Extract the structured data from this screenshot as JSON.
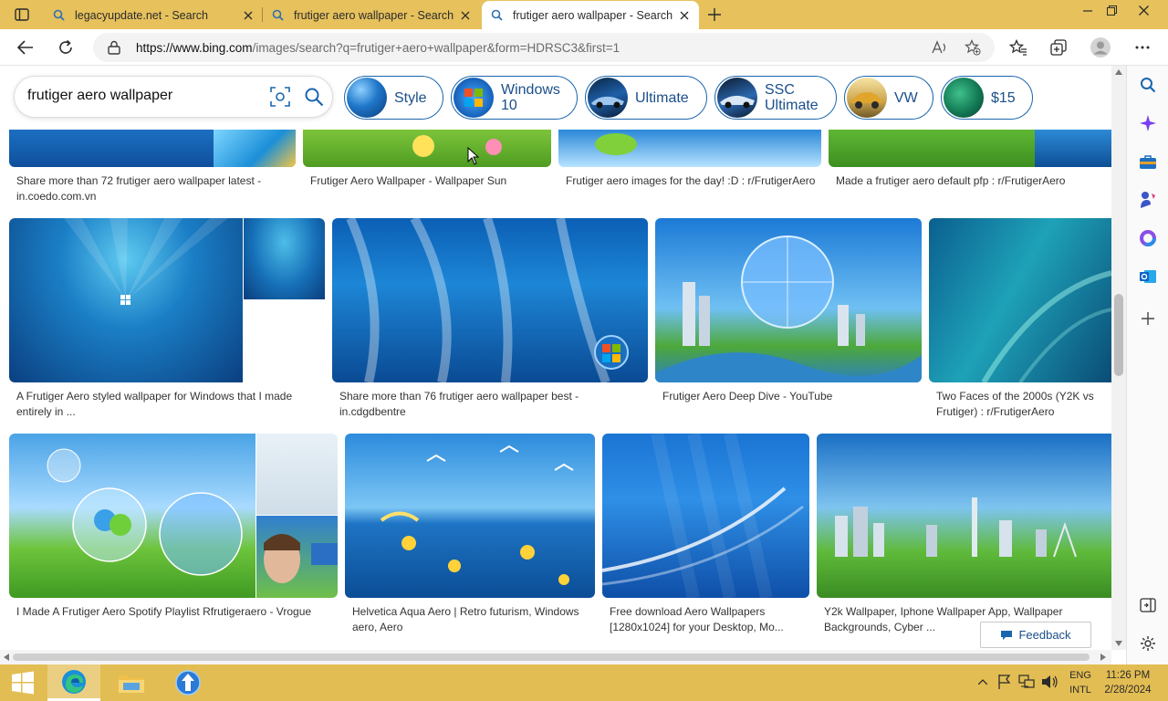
{
  "browser": {
    "tabs": [
      {
        "title": "legacyupdate.net - Search",
        "active": false
      },
      {
        "title": "frutiger aero wallpaper - Search",
        "active": false
      },
      {
        "title": "frutiger aero wallpaper - Search",
        "active": true
      }
    ],
    "url_host": "https://www.bing.com",
    "url_path": "/images/search?q=frutiger+aero+wallpaper&form=HDRSC3&first=1"
  },
  "search": {
    "query": "frutiger aero wallpaper",
    "chips": [
      {
        "label": "Style"
      },
      {
        "label": "Windows\n10"
      },
      {
        "label": "Ultimate"
      },
      {
        "label": "SSC\nUltimate"
      },
      {
        "label": "VW"
      },
      {
        "label": "$15"
      }
    ]
  },
  "results": {
    "row1": [
      {
        "caption": "Share more than 72 frutiger aero wallpaper latest - in.coedo.com.vn"
      },
      {
        "caption": "Frutiger Aero Wallpaper - Wallpaper Sun"
      },
      {
        "caption": "Frutiger aero images for the day! :D : r/FrutigerAero"
      },
      {
        "caption": "Made a frutiger aero default pfp : r/FrutigerAero"
      }
    ],
    "row2": [
      {
        "caption": "A Frutiger Aero styled wallpaper for Windows that I made entirely in ..."
      },
      {
        "caption": "Share more than 76 frutiger aero wallpaper best - in.cdgdbentre"
      },
      {
        "caption": "Frutiger Aero Deep Dive - YouTube"
      },
      {
        "caption": "Two Faces of the 2000s (Y2K vs Frutiger) : r/FrutigerAero"
      }
    ],
    "row3": [
      {
        "caption": "I Made A Frutiger Aero Spotify Playlist Rfrutigeraero - Vrogue"
      },
      {
        "caption": "Helvetica Aqua Aero | Retro futurism, Windows aero, Aero"
      },
      {
        "caption": "Free download Aero Wallpapers [1280x1024] for your Desktop, Mo..."
      },
      {
        "caption": "Y2k Wallpaper, Iphone Wallpaper App, Wallpaper Backgrounds, Cyber ..."
      }
    ]
  },
  "feedback_label": "Feedback",
  "taskbar": {
    "lang_line1": "ENG",
    "lang_line2": "INTL",
    "time": "11:26 PM",
    "date": "2/28/2024"
  },
  "colors": {
    "tabstrip": "#e6c15c",
    "taskbar": "#e2bd53",
    "chip_border": "#1a66ad",
    "chip_text": "#1a4f8a"
  }
}
